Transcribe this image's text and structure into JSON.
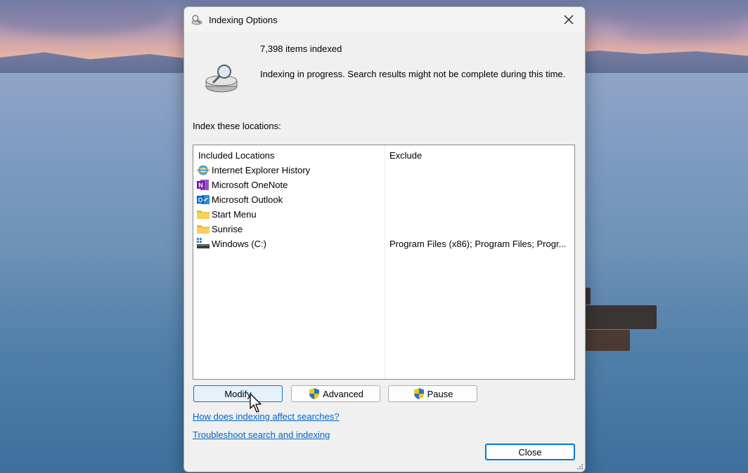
{
  "window": {
    "title": "Indexing Options",
    "items_indexed": "7,398 items indexed",
    "status": "Indexing in progress. Search results might not be complete during this time."
  },
  "locations": {
    "label": "Index these locations:",
    "headers": {
      "included": "Included Locations",
      "exclude": "Exclude"
    },
    "rows": [
      {
        "icon": "internet-explorer-icon",
        "name": "Internet Explorer History",
        "exclude": ""
      },
      {
        "icon": "onenote-icon",
        "name": "Microsoft OneNote",
        "exclude": ""
      },
      {
        "icon": "outlook-icon",
        "name": "Microsoft Outlook",
        "exclude": ""
      },
      {
        "icon": "folder-icon",
        "name": "Start Menu",
        "exclude": ""
      },
      {
        "icon": "folder-icon",
        "name": "Sunrise",
        "exclude": ""
      },
      {
        "icon": "drive-icon",
        "name": "Windows (C:)",
        "exclude": "Program Files (x86); Program Files; Progr..."
      }
    ]
  },
  "buttons": {
    "modify": "Modify",
    "advanced": "Advanced",
    "pause": "Pause",
    "close": "Close"
  },
  "links": {
    "how_affects": "How does indexing affect searches?",
    "troubleshoot": "Troubleshoot search and indexing"
  },
  "colors": {
    "accent": "#0078d7",
    "link": "#0066cc",
    "dialog_bg": "#f0f0f0"
  }
}
